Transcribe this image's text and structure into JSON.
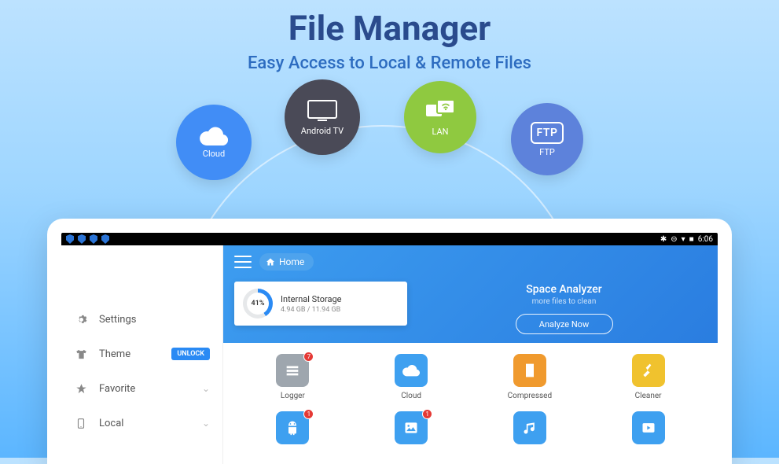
{
  "hero": {
    "title": "File Manager",
    "subtitle": "Easy Access to Local & Remote Files"
  },
  "feature_badges": {
    "cloud": "Cloud",
    "android_tv": "Android TV",
    "lan": "LAN",
    "ftp": "FTP"
  },
  "statusbar": {
    "time": "6:06",
    "bt_icon": "✱",
    "dnd_icon": "⊖",
    "wifi_icon": "▾",
    "batt_icon": "■"
  },
  "sidebar": {
    "items": [
      {
        "label": "Settings"
      },
      {
        "label": "Theme",
        "badge": "UNLOCK"
      },
      {
        "label": "Favorite"
      },
      {
        "label": "Local"
      }
    ]
  },
  "header": {
    "home_label": "Home",
    "storage": {
      "title": "Internal Storage",
      "detail": "4.94 GB / 11.94 GB",
      "percent": "41%"
    },
    "analyzer": {
      "title": "Space Analyzer",
      "subtitle": "more files to clean",
      "button": "Analyze Now"
    }
  },
  "tiles": [
    {
      "label": "Logger",
      "color": "c-grey",
      "badge": "7"
    },
    {
      "label": "Cloud",
      "color": "c-blue"
    },
    {
      "label": "Compressed",
      "color": "c-orange"
    },
    {
      "label": "Cleaner",
      "color": "c-yellow"
    },
    {
      "label": "",
      "color": "c-blue",
      "badge": "1"
    },
    {
      "label": "",
      "color": "c-blue",
      "badge": "1"
    },
    {
      "label": "",
      "color": "c-blue"
    },
    {
      "label": "",
      "color": "c-blue"
    }
  ]
}
